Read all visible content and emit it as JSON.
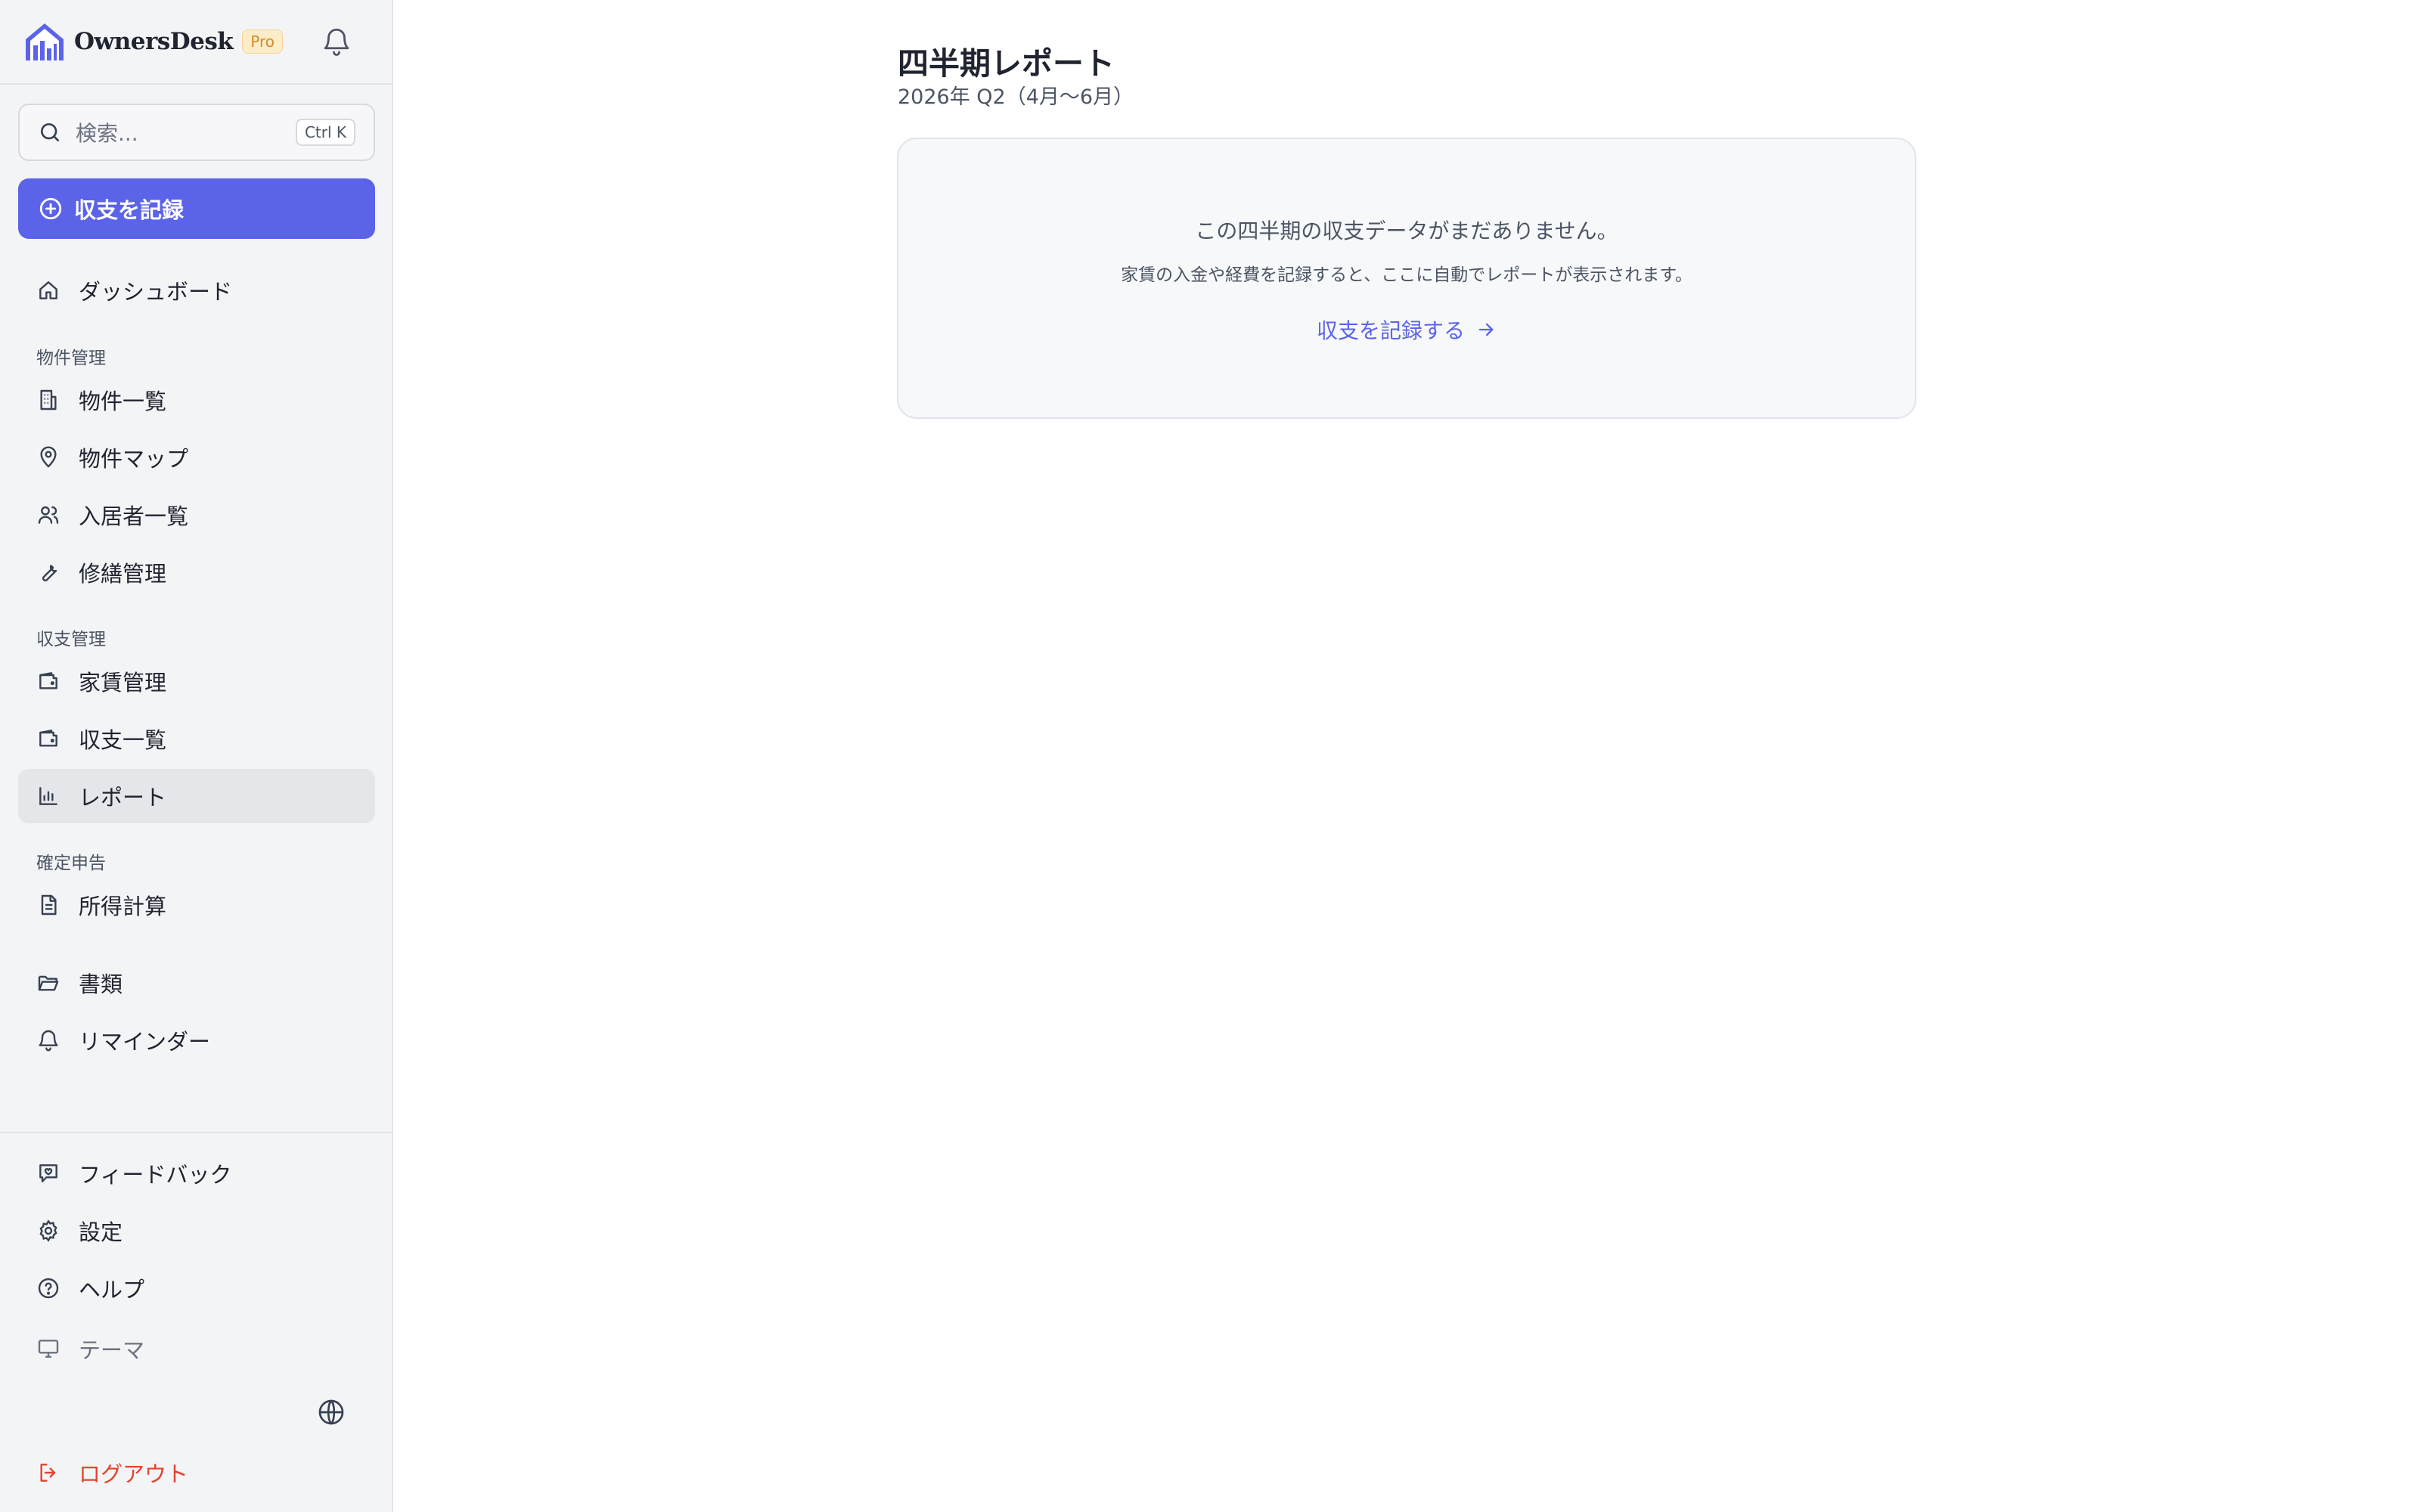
{
  "app": {
    "brand_name": "OwnersDesk",
    "plan_badge": "Pro",
    "accent_color": "#5b63e8",
    "logout_color": "#e0452f"
  },
  "search": {
    "placeholder": "検索...",
    "shortcut": "Ctrl K"
  },
  "primary_action": {
    "label": "収支を記録",
    "icon": "plus-circle-icon"
  },
  "nav": {
    "dashboard": "ダッシュボード",
    "section_properties": "物件管理",
    "properties_list": "物件一覧",
    "properties_map": "物件マップ",
    "tenants_list": "入居者一覧",
    "repairs": "修繕管理",
    "section_finance": "収支管理",
    "rent": "家賃管理",
    "income_expense_list": "収支一覧",
    "reports": "レポート",
    "section_tax": "確定申告",
    "income_calc": "所得計算",
    "documents": "書類",
    "reminders": "リマインダー",
    "feedback": "フィードバック",
    "settings": "設定",
    "help": "ヘルプ",
    "theme": "テーマ",
    "logout": "ログアウト"
  },
  "active_nav": "reports",
  "main": {
    "title": "四半期レポート",
    "subtitle": "2026年 Q2（4月〜6月）",
    "empty_state": {
      "title": "この四半期の収支データがまだありません。",
      "description": "家賃の入金や経費を記録すると、ここに自動でレポートが表示されます。",
      "link_label": "収支を記録する"
    }
  }
}
